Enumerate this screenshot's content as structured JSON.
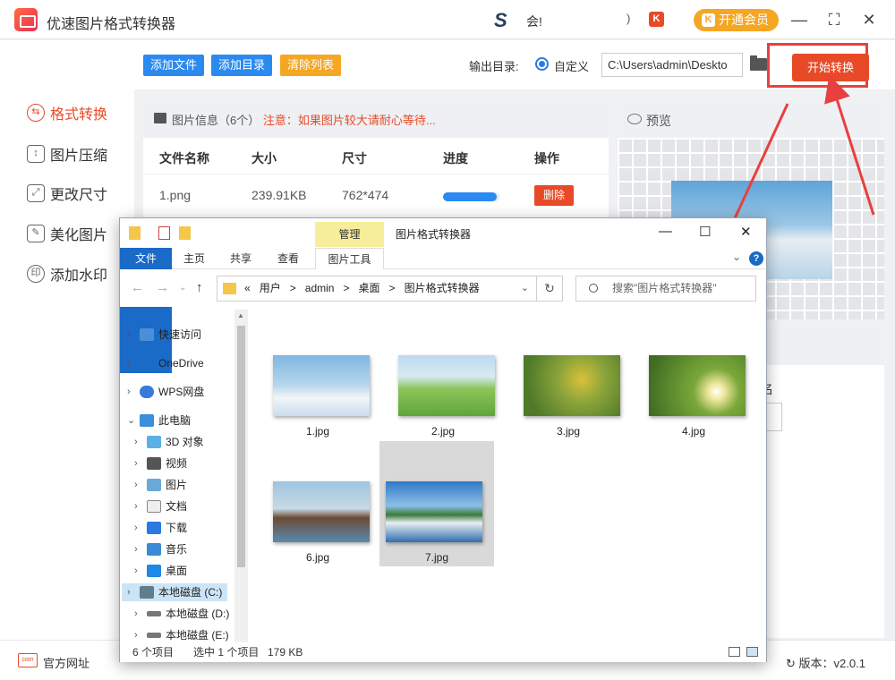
{
  "app": {
    "title": "优速图片格式转换器",
    "ts_text": "会!",
    "paren": ")",
    "kw_badge": "K",
    "vip_label": "开通会员",
    "vip_badge": "K",
    "win_min": "—",
    "win_max": "⛶",
    "win_close": "✕"
  },
  "sidebar": {
    "items": [
      {
        "label": "格式转换",
        "icon": "format-convert-icon",
        "active": true
      },
      {
        "label": "图片压缩",
        "icon": "compress-icon"
      },
      {
        "label": "更改尺寸",
        "icon": "resize-icon"
      },
      {
        "label": "美化图片",
        "icon": "beautify-icon"
      },
      {
        "label": "添加水印",
        "icon": "watermark-icon"
      }
    ]
  },
  "toolbar": {
    "add_file": "添加文件",
    "add_dir": "添加目录",
    "clear_list": "清除列表",
    "output_label": "输出目录:",
    "custom_label": "自定义",
    "path_value": "C:\\Users\\admin\\Deskto",
    "start_label": "开始转换"
  },
  "colors": {
    "accent_orange": "#e84a27",
    "button_blue": "#2a8af0",
    "button_gold": "#f5a623",
    "annotation_red": "#e84040"
  },
  "file_panel": {
    "info": "图片信息（6个）",
    "warning": "注意：如果图片较大请耐心等待...",
    "columns": [
      "文件名称",
      "大小",
      "尺寸",
      "进度",
      "操作"
    ],
    "rows": [
      {
        "name": "1.png",
        "size": "239.91KB",
        "dims": "762*474",
        "progress": 0.95,
        "action": "删除"
      }
    ]
  },
  "preview": {
    "title": "预览"
  },
  "right_lower": {
    "label_fragment": "名"
  },
  "footer": {
    "official": "官方网址",
    "version_label": "版本：v2.0.1"
  },
  "explorer": {
    "manage_tab": "管理",
    "window_title": "图片格式转换器",
    "wbtn_min": "—",
    "wbtn_max": "☐",
    "wbtn_close": "✕",
    "tabs": [
      "文件",
      "主页",
      "共享",
      "查看",
      "图片工具"
    ],
    "help": "?",
    "address": [
      "«",
      "用户",
      ">",
      "admin",
      ">",
      "桌面",
      ">",
      "图片格式转换器"
    ],
    "search_placeholder": "搜索\"图片格式转换器\"",
    "nav": [
      {
        "label": "快速访问",
        "icon": "star-icon"
      },
      {
        "label": "OneDrive",
        "icon": "cloud-icon"
      },
      {
        "label": "WPS网盘",
        "icon": "cloud-icon"
      },
      {
        "label": "此电脑",
        "icon": "computer-icon"
      },
      {
        "label": "3D 对象",
        "icon": "3d-icon"
      },
      {
        "label": "视频",
        "icon": "video-icon"
      },
      {
        "label": "图片",
        "icon": "picture-icon"
      },
      {
        "label": "文档",
        "icon": "document-icon"
      },
      {
        "label": "下载",
        "icon": "download-icon"
      },
      {
        "label": "音乐",
        "icon": "music-icon"
      },
      {
        "label": "桌面",
        "icon": "desktop-icon"
      },
      {
        "label": "本地磁盘 (C:)",
        "icon": "drive-icon"
      },
      {
        "label": "本地磁盘 (D:)",
        "icon": "drive-icon"
      },
      {
        "label": "本地磁盘 (E:)",
        "icon": "drive-icon"
      }
    ],
    "files": [
      {
        "name": "1.jpg"
      },
      {
        "name": "2.jpg"
      },
      {
        "name": "3.jpg"
      },
      {
        "name": "4.jpg"
      },
      {
        "name": "6.jpg"
      },
      {
        "name": "7.jpg"
      }
    ],
    "status": {
      "count": "6 个项目",
      "selected": "选中 1 个项目",
      "size": "179 KB"
    }
  }
}
